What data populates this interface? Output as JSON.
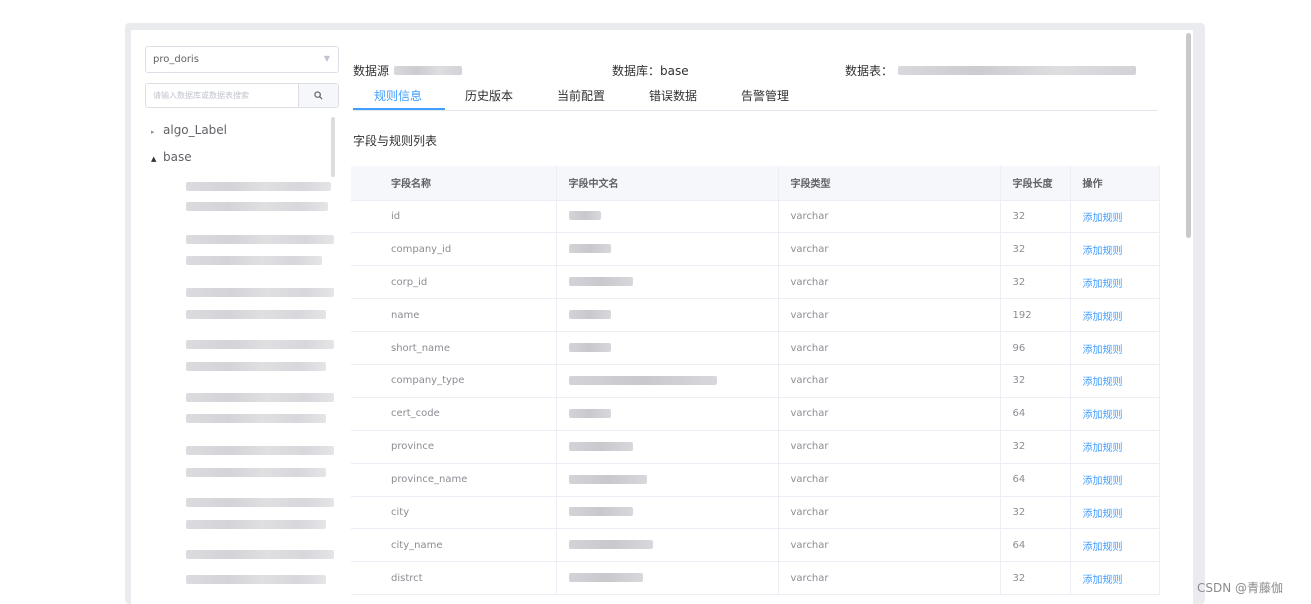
{
  "sidebar": {
    "db_select": "pro_doris",
    "search_placeholder": "请输入数据库或数据表搜索",
    "tree": [
      {
        "label": "algo_Label",
        "expanded": false
      },
      {
        "label": "base",
        "expanded": true
      }
    ]
  },
  "header": {
    "datasource_label": "数据源",
    "database_label": "数据库：base",
    "table_label": "数据表："
  },
  "tabs": [
    "规则信息",
    "历史版本",
    "当前配置",
    "错误数据",
    "告警管理"
  ],
  "active_tab": "规则信息",
  "section_title": "字段与规则列表",
  "table": {
    "headers": [
      "字段名称",
      "字段中文名",
      "字段类型",
      "字段长度",
      "操作"
    ],
    "rows": [
      {
        "name": "id",
        "type": "varchar",
        "length": "32",
        "op": "添加规则"
      },
      {
        "name": "company_id",
        "type": "varchar",
        "length": "32",
        "op": "添加规则"
      },
      {
        "name": "corp_id",
        "type": "varchar",
        "length": "32",
        "op": "添加规则"
      },
      {
        "name": "name",
        "type": "varchar",
        "length": "192",
        "op": "添加规则"
      },
      {
        "name": "short_name",
        "type": "varchar",
        "length": "96",
        "op": "添加规则"
      },
      {
        "name": "company_type",
        "type": "varchar",
        "length": "32",
        "op": "添加规则"
      },
      {
        "name": "cert_code",
        "type": "varchar",
        "length": "64",
        "op": "添加规则"
      },
      {
        "name": "province",
        "type": "varchar",
        "length": "32",
        "op": "添加规则"
      },
      {
        "name": "province_name",
        "type": "varchar",
        "length": "64",
        "op": "添加规则"
      },
      {
        "name": "city",
        "type": "varchar",
        "length": "32",
        "op": "添加规则"
      },
      {
        "name": "city_name",
        "type": "varchar",
        "length": "64",
        "op": "添加规则"
      },
      {
        "name": "distrct",
        "type": "varchar",
        "length": "32",
        "op": "添加规则"
      }
    ]
  },
  "watermark": "CSDN @青藤伽",
  "colors": {
    "accent": "#409eff",
    "header_bg": "#f5f7fa",
    "border": "#ebeef5"
  }
}
